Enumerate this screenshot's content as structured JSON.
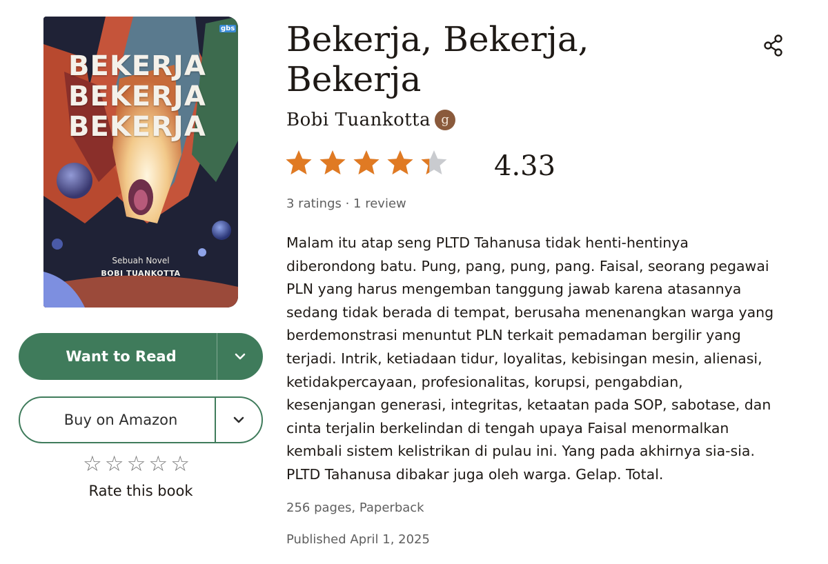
{
  "cover": {
    "title_lines": [
      "BEKERJA",
      "BEKERJA",
      "BEKERJA"
    ],
    "subtitle": "Sebuah Novel",
    "author": "BOBI TUANKOTTA",
    "publisher_mark": "gbs"
  },
  "book": {
    "title_lines": [
      "Bekerja, Bekerja,",
      "Bekerja"
    ],
    "author": "Bobi Tuankotta",
    "author_badge": "g",
    "rating": {
      "value": 4.33,
      "display": "4.33",
      "max": 5
    },
    "ratings_line": "3 ratings · 1 review",
    "description_lines": [
      "Malam itu atap seng PLTD Tahanusa tidak henti-hentinya",
      "diberondong batu. Pung, pang, pung, pang. Faisal, seorang pegawai",
      "PLN yang harus mengemban tanggung jawab karena atasannya",
      "sedang tidak berada di tempat, berusaha menenangkan warga yang",
      "berdemonstrasi menuntut PLN terkait pemadaman bergilir yang",
      "terjadi. Intrik, ketiadaan tidur, loyalitas, kebisingan mesin, alienasi,",
      "ketidakpercayaan, profesionalitas, korupsi, pengabdian,",
      "kesenjangan generasi, integritas, ketaatan pada SOP, sabotase, dan",
      "cinta terjalin berkelindan di tengah upaya Faisal menormalkan",
      "kembali sistem kelistrikan di pulau ini. Yang pada akhirnya sia-sia.",
      "PLTD Tahanusa dibakar juga oleh warga. Gelap. Total."
    ],
    "details": "256 pages, Paperback",
    "published": "Published April 1, 2025"
  },
  "actions": {
    "want_to_read": "Want to Read",
    "buy": "Buy on Amazon",
    "rate_label": "Rate this book",
    "rate_star_glyph": "☆"
  },
  "icons": {
    "share": "share-icon",
    "caret": "chevron-down-icon",
    "star": "star-icon"
  },
  "colors": {
    "accent_green": "#3f7b5b",
    "star_orange": "#e07a23",
    "star_empty": "#c9cbcf",
    "text_primary": "#1e1915",
    "text_secondary": "#5f5f5f"
  }
}
